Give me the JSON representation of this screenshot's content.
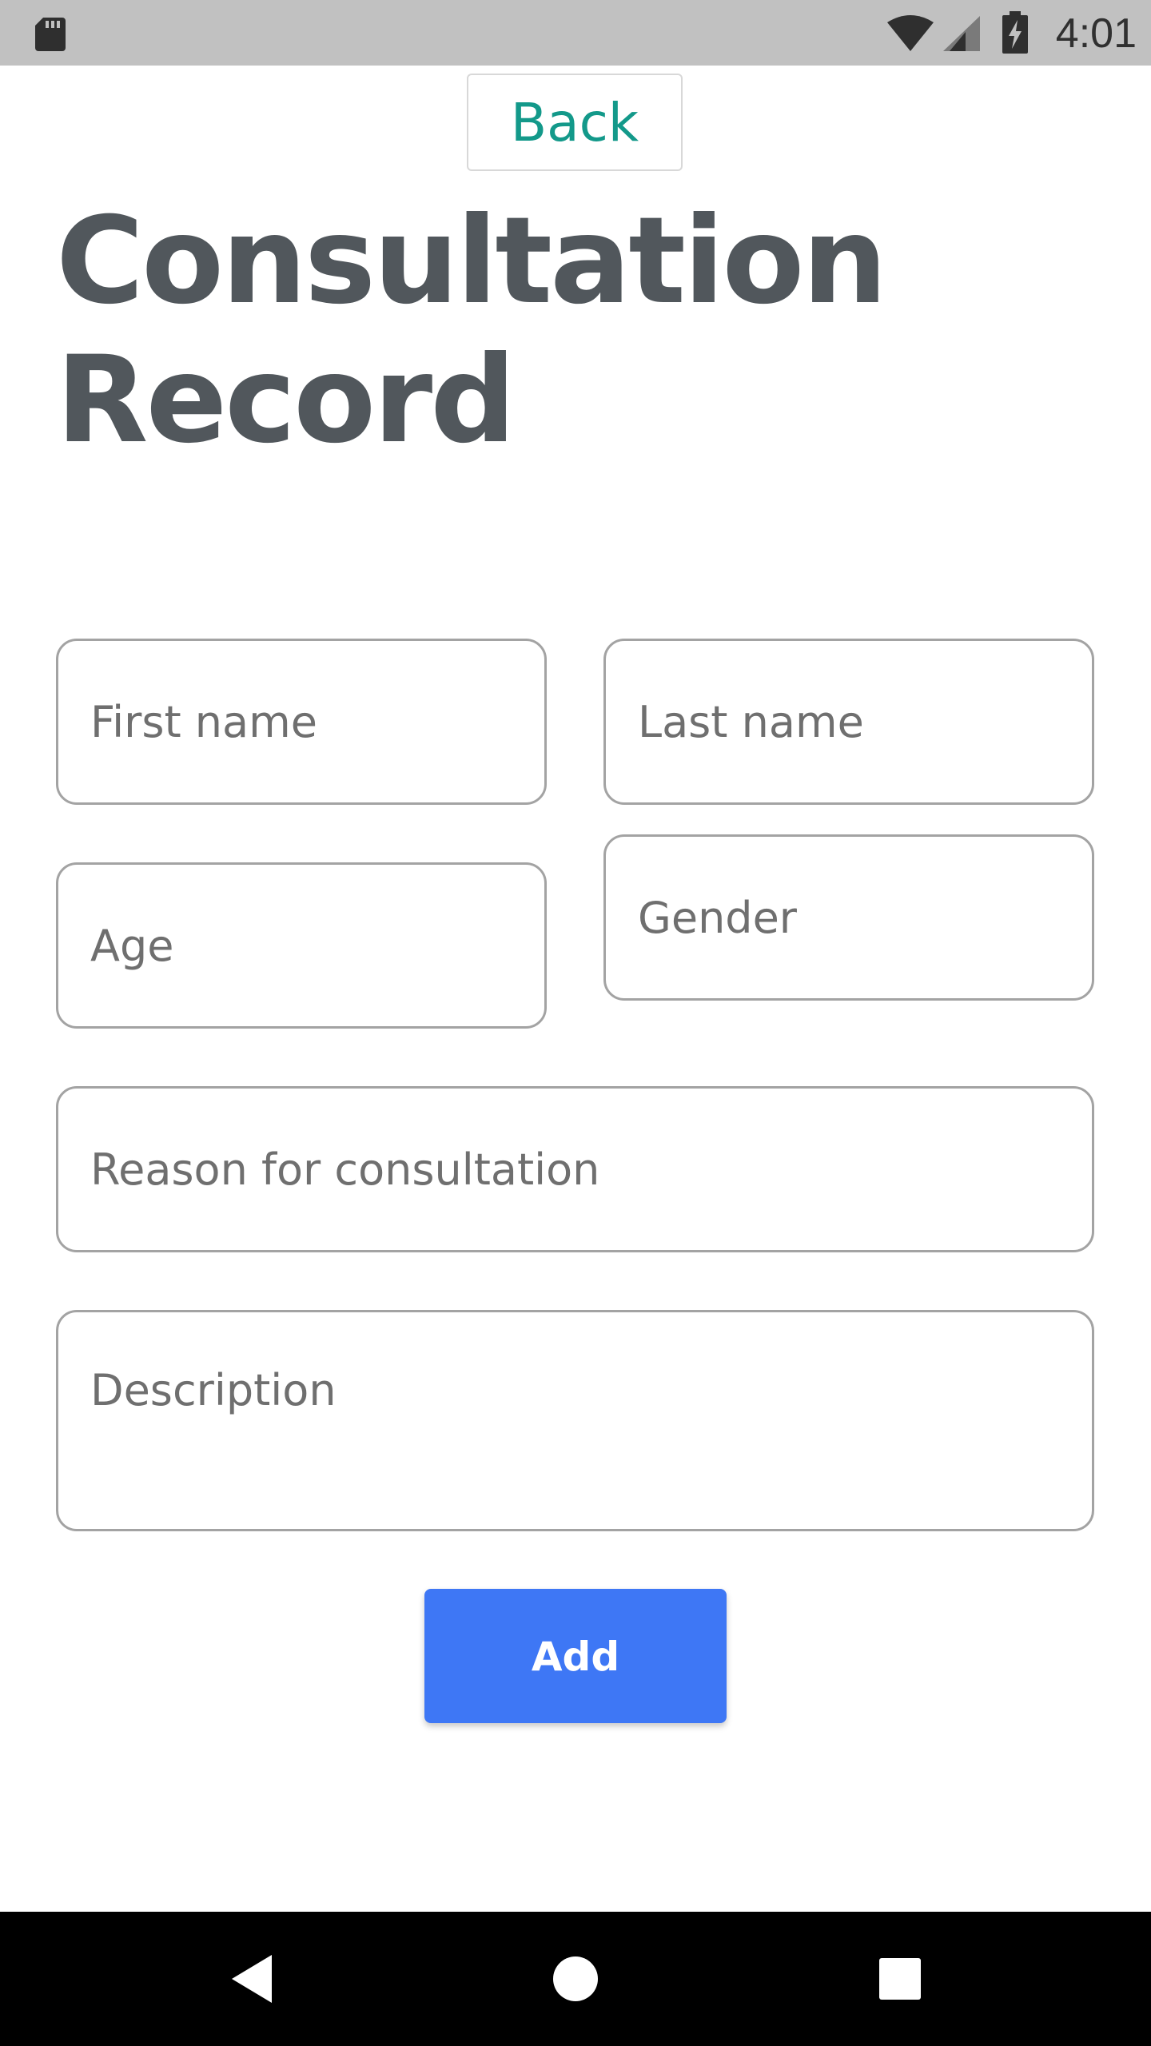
{
  "status_bar": {
    "time": "4:01",
    "icons": [
      "sd-card-icon",
      "wifi-icon",
      "cell-signal-icon",
      "battery-charging-icon"
    ]
  },
  "header": {
    "back_label": "Back",
    "title_line1": "Consultation",
    "title_line2": "Record"
  },
  "form": {
    "first_name": {
      "placeholder": "First name",
      "value": ""
    },
    "last_name": {
      "placeholder": "Last name",
      "value": ""
    },
    "age": {
      "placeholder": "Age",
      "value": ""
    },
    "gender": {
      "placeholder": "Gender",
      "value": ""
    },
    "reason": {
      "placeholder": "Reason for consultation",
      "value": ""
    },
    "description": {
      "placeholder": "Description",
      "value": ""
    },
    "add_label": "Add"
  },
  "nav_bar": {
    "buttons": [
      "back-triangle-icon",
      "home-circle-icon",
      "recents-square-icon"
    ]
  },
  "colors": {
    "status_bar_bg": "#c1c1c1",
    "accent_teal": "#13998a",
    "title_text": "#51575c",
    "field_border": "#a3a3a3",
    "primary_button": "#3e77f5",
    "nav_bar_bg": "#000000"
  }
}
